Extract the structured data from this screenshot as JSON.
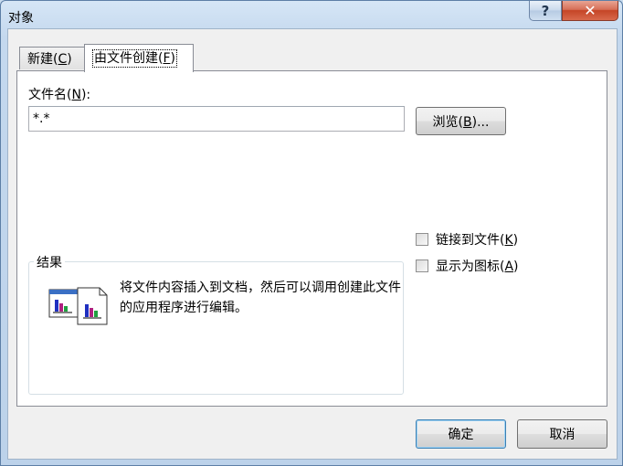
{
  "window": {
    "title": "对象",
    "help_label": "?",
    "close_label": "✕"
  },
  "tabs": [
    {
      "label_prefix": "新建(",
      "accel": "C",
      "label_suffix": ")"
    },
    {
      "label_prefix": "由文件创建(",
      "accel": "F",
      "label_suffix": ")"
    }
  ],
  "file": {
    "label_prefix": "文件名(",
    "accel": "N",
    "label_suffix": "):",
    "value": "*.*"
  },
  "browse": {
    "label_prefix": "浏览(",
    "accel": "B",
    "label_suffix": ")..."
  },
  "options": [
    {
      "label_prefix": "链接到文件(",
      "accel": "K",
      "label_suffix": ")",
      "checked": false
    },
    {
      "label_prefix": "显示为图标(",
      "accel": "A",
      "label_suffix": ")",
      "checked": false
    }
  ],
  "result": {
    "title": "结果",
    "text": "将文件内容插入到文档，然后可以调用创建此文件的应用程序进行编辑。",
    "icon": "insert-file-object-icon"
  },
  "buttons": {
    "ok": "确定",
    "cancel": "取消"
  }
}
